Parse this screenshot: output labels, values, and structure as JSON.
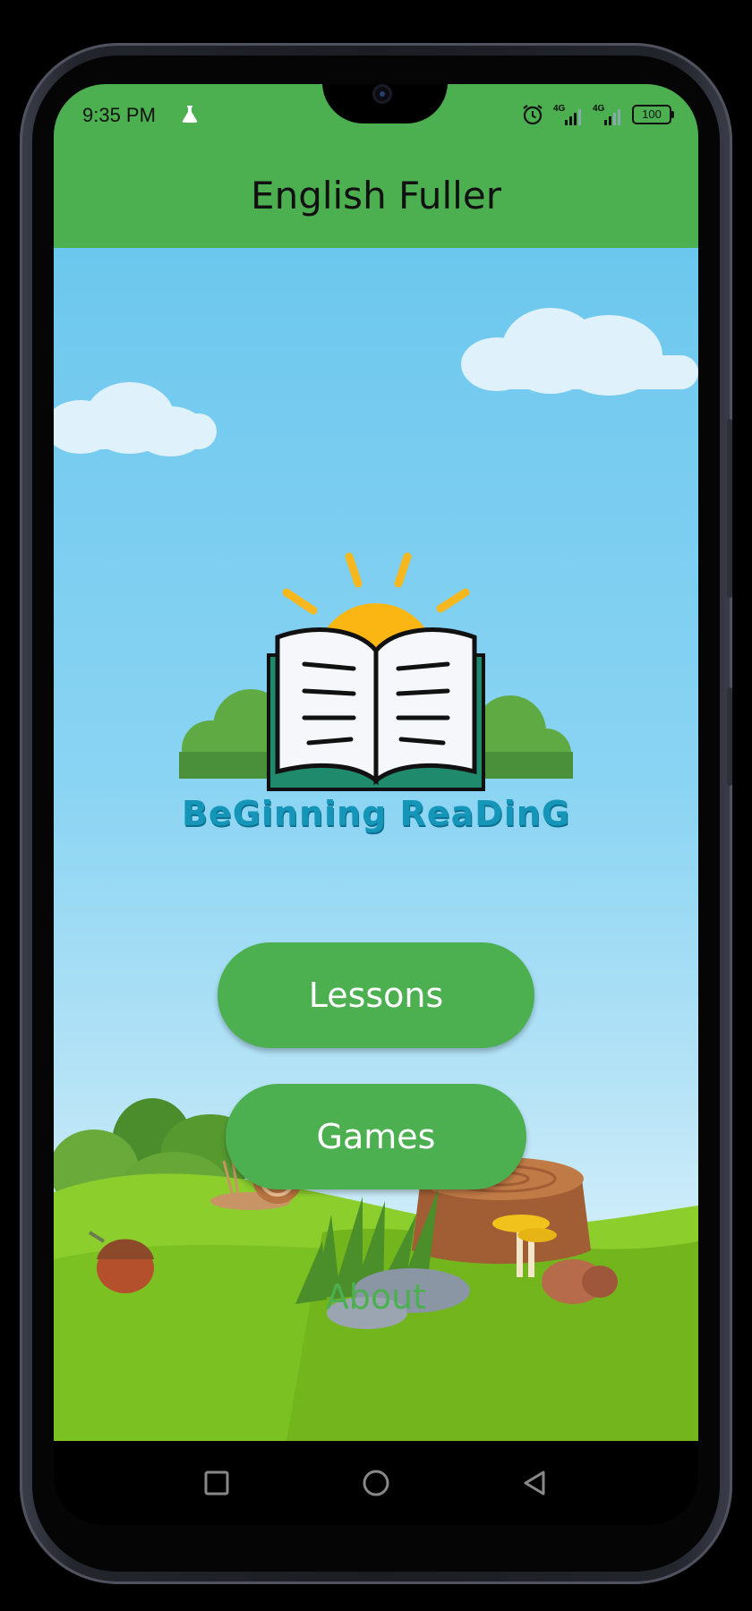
{
  "status_bar": {
    "time": "9:35 PM",
    "battery": "100",
    "signal_1_label": "4G",
    "signal_2_label": "4G",
    "icons": [
      "flask-icon",
      "alarm-icon",
      "signal-icon",
      "battery-icon"
    ]
  },
  "app_bar": {
    "title": "English Fuller"
  },
  "logo": {
    "text": "BeGinning ReaDinG"
  },
  "menu": {
    "lessons_label": "Lessons",
    "games_label": "Games",
    "about_label": "About"
  },
  "nav_bar": {
    "icons": [
      "recent-apps-icon",
      "home-icon",
      "back-icon"
    ]
  },
  "colors": {
    "accent": "#4caf50",
    "sky_top": "#6cc7ee",
    "sky_bottom": "#d6f0fb",
    "logo_text": "#1596b8",
    "sun": "#fbb614"
  }
}
